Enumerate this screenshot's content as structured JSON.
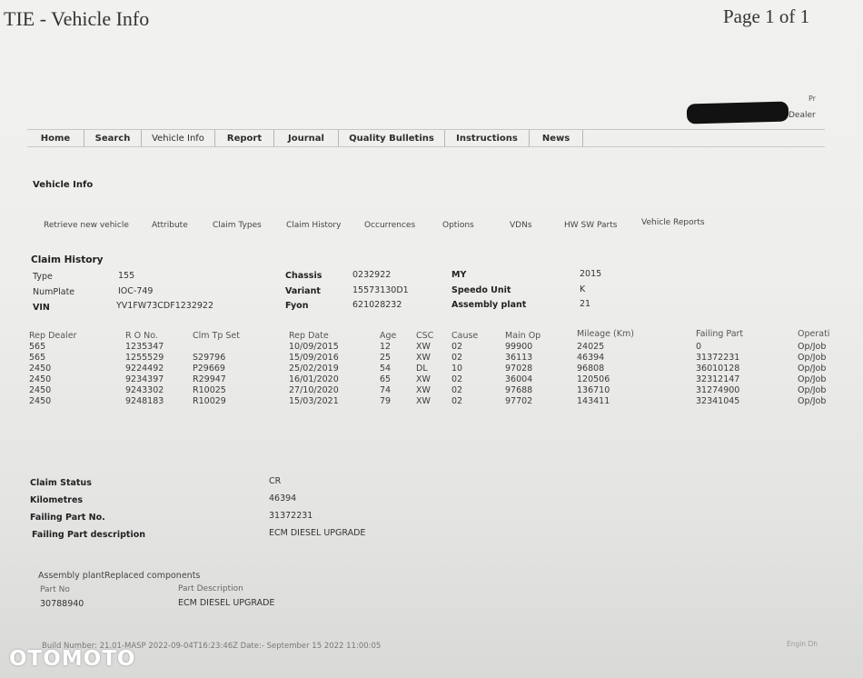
{
  "header": {
    "title": "TIE - Vehicle Info",
    "page": "Page 1 of 1",
    "pr": "Pr",
    "dealer": "Dealer"
  },
  "nav": [
    "Home",
    "Search",
    "Vehicle Info",
    "Report",
    "Journal",
    "Quality Bulletins",
    "Instructions",
    "News"
  ],
  "section_title": "Vehicle Info",
  "subnav": [
    "Retrieve new vehicle",
    "Attribute",
    "Claim Types",
    "Claim History",
    "Occurrences",
    "Options",
    "VDNs",
    "HW SW Parts",
    "Vehicle Reports"
  ],
  "claim_history": {
    "title": "Claim History",
    "type_label": "Type",
    "type_value": "155",
    "numplate_label": "NumPlate",
    "numplate_value": "IOC-749",
    "vin_label": "VIN",
    "vin_value": "YV1FW73CDF1232922",
    "chassis_label": "Chassis",
    "chassis_value": "0232922",
    "variant_label": "Variant",
    "variant_value": "15573130D1",
    "fyon_label": "Fyon",
    "fyon_value": "621028232",
    "my_label": "MY",
    "my_value": "2015",
    "speedo_label": "Speedo Unit",
    "speedo_value": "K",
    "assembly_label": "Assembly plant",
    "assembly_value": "21"
  },
  "table": {
    "headers": [
      "Rep Dealer",
      "R O No.",
      "Clm Tp Set",
      "Rep Date",
      "Age",
      "CSC",
      "Cause",
      "Main Op",
      "Mileage (Km)",
      "Failing Part",
      "Operati"
    ],
    "rows": [
      [
        "565",
        "1235347",
        "",
        "10/09/2015",
        "12",
        "XW",
        "02",
        "99900",
        "24025",
        "0",
        "Op/Job"
      ],
      [
        "565",
        "1255529",
        "S29796",
        "15/09/2016",
        "25",
        "XW",
        "02",
        "36113",
        "46394",
        "31372231",
        "Op/Job"
      ],
      [
        "2450",
        "9224492",
        "P29669",
        "25/02/2019",
        "54",
        "DL",
        "10",
        "97028",
        "96808",
        "36010128",
        "Op/Job"
      ],
      [
        "2450",
        "9234397",
        "R29947",
        "16/01/2020",
        "65",
        "XW",
        "02",
        "36004",
        "120506",
        "32312147",
        "Op/Job"
      ],
      [
        "2450",
        "9243302",
        "R10025",
        "27/10/2020",
        "74",
        "XW",
        "02",
        "97688",
        "136710",
        "31274900",
        "Op/Job"
      ],
      [
        "2450",
        "9248183",
        "R10029",
        "15/03/2021",
        "79",
        "XW",
        "02",
        "97702",
        "143411",
        "32341045",
        "Op/Job"
      ]
    ]
  },
  "claim_details": {
    "status_label": "Claim Status",
    "status_value": "CR",
    "km_label": "Kilometres",
    "km_value": "46394",
    "part_label": "Failing Part No.",
    "part_value": "31372231",
    "desc_label": "Failing Part description",
    "desc_value": "ECM DIESEL UPGRADE"
  },
  "replaced": {
    "title": "Assembly plantReplaced components",
    "col1": "Part No",
    "col2": "Part Description",
    "part_no": "30788940",
    "part_desc": "ECM DIESEL UPGRADE"
  },
  "footer": {
    "build": "Build Number: 21.01-MASP 2022-09-04T16:23:46Z  Date:- September 15 2022 11:00:05",
    "right": "Engin Dh"
  },
  "watermark": "OTOMOTO"
}
